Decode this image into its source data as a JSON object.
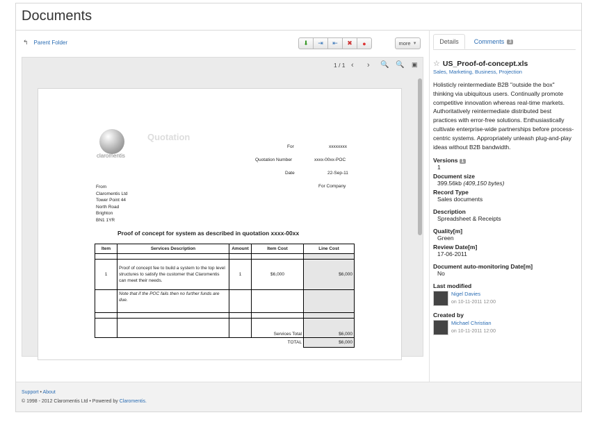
{
  "page": {
    "title": "Documents"
  },
  "nav": {
    "parent_folder": "Parent Folder",
    "more": "more"
  },
  "viewer": {
    "page_indicator": "1 / 1"
  },
  "sheet": {
    "logo_text": "claromentis",
    "heading": "Quotation",
    "for_label": "For",
    "for_value": "xxxxxxxx",
    "qnum_label": "Quotation Number",
    "qnum_value": "xxxx-00xx-POC",
    "date_label": "Date",
    "date_value": "22-Sep-11",
    "for_company": "For Company",
    "from_lines": [
      "From",
      "Claromentis Ltd",
      "Tower Point 44",
      "North Road",
      "Brighton",
      "BN1 1YR"
    ],
    "proof_title": "Proof of concept for system as described in quotation xxxx-00xx",
    "table_headers": [
      "Item",
      "Services Description",
      "Amount",
      "Item Cost",
      "Line Cost"
    ],
    "row1": {
      "item": "1",
      "desc": "Proof of concept fee to build a system to the top level structures to satisfy the customer that Claromentis can meet their needs.",
      "amount": "1",
      "item_cost": "$6,000",
      "line_cost": "$6,000"
    },
    "note": "Note that if the POC fails then no further funds are due.",
    "services_total_label": "Services Total",
    "services_total_value": "$6,000",
    "total_label": "TOTAL",
    "total_value": "$6,000"
  },
  "tabs": {
    "details": "Details",
    "comments": "Comments",
    "comments_count": "3"
  },
  "details": {
    "file_name": "US_Proof-of-concept.xls",
    "tags": "Sales, Marketing, Business, Projection",
    "description": "Holisticly reintermediate B2B \"outside the box\" thinking via ubiquitous users. Continually promote competitive innovation whereas real-time markets. Authoritatively reintermediate distributed best practices with error-free solutions. Enthusiastically cultivate enterprise-wide partnerships before process-centric systems. Appropriately unleash plug-and-play ideas without B2B bandwidth.",
    "versions_label": "Versions",
    "versions_badge": "1",
    "versions_value": "1",
    "size_label": "Document size",
    "size_value": "399.56kb",
    "size_bytes": "(409,150 bytes)",
    "record_type_label": "Record Type",
    "record_type_value": "Sales documents",
    "description_label": "Description",
    "description_value": "Spreadsheet & Receipts",
    "quality_label": "Quality[m]",
    "quality_value": "Green",
    "review_label": "Review Date[m]",
    "review_value": "17-06-2011",
    "auto_label": "Document auto-monitoring Date[m]",
    "auto_value": "No",
    "last_modified_label": "Last modified",
    "modified_by": "Nigel Davies",
    "modified_on": "on 10-11-2011 12:00",
    "created_label": "Created by",
    "created_by": "Michael Christian",
    "created_on": "on 10-11-2011 12:00"
  },
  "footer": {
    "support": "Support",
    "about": "About",
    "copyright": "© 1998 - 2012 Claromentis Ltd • Powered by",
    "powered_link": "Claromentis."
  }
}
